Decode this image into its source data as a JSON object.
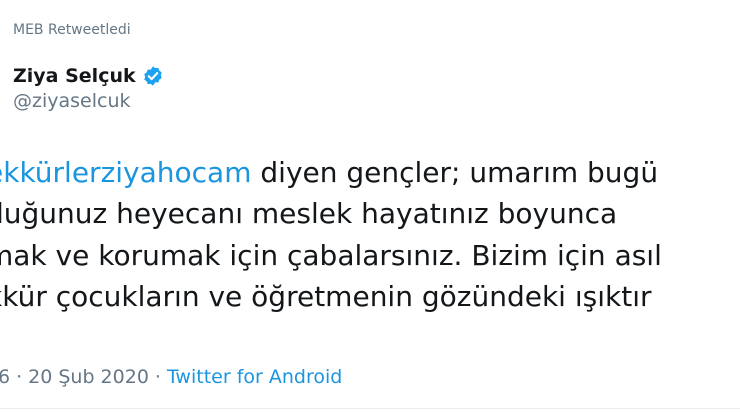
{
  "retweet": {
    "label": "MEB Retweetledi"
  },
  "author": {
    "display_name": "Ziya Selçuk",
    "handle": "@ziyaselcuk",
    "verified_icon": "verified-badge-icon"
  },
  "tweet": {
    "line1_hashtag": "ekkürlerziyahocam",
    "line1_rest": " diyen gençler; umarım bugü",
    "line2": "duğunuz heyecanı meslek hayatınız boyunca",
    "line3": "mak ve korumak için çabalarsınız. Bizim için asıl",
    "line4": "kkür çocukların ve öğretmenin gözündeki ışıktır"
  },
  "meta": {
    "time_fragment": "6",
    "date": "20 Şub 2020",
    "source": "Twitter for Android"
  },
  "colors": {
    "link": "#1b95e0",
    "secondary_text": "#657786",
    "primary_text": "#14171a",
    "verified": "#1da1f2"
  }
}
